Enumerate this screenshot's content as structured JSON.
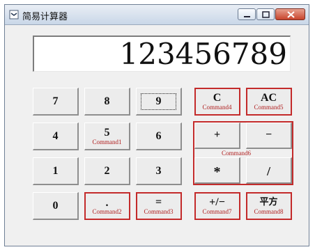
{
  "window": {
    "title": "简易计算器"
  },
  "display": {
    "value": "123456789"
  },
  "keys": {
    "k7": "7",
    "k8": "8",
    "k9": "9",
    "k4": "4",
    "k5": "5",
    "k6": "6",
    "k1": "1",
    "k2": "2",
    "k3": "3",
    "k0": "0",
    "clear": "C",
    "all_clear": "AC",
    "plus": "+",
    "minus": "−",
    "multiply": "*",
    "divide": "/",
    "dot": ".",
    "equals": "=",
    "sign": "+/−",
    "square": "平方"
  },
  "annotations": {
    "command1": "Command1",
    "command2": "Command2",
    "command3": "Command3",
    "command4": "Command4",
    "command5": "Command5",
    "command6": "Command6",
    "command7": "Command7",
    "command8": "Command8"
  },
  "colors": {
    "annotation_red": "#c32a2a",
    "button_face": "#ececec",
    "window_bg": "#f0f0f0"
  }
}
